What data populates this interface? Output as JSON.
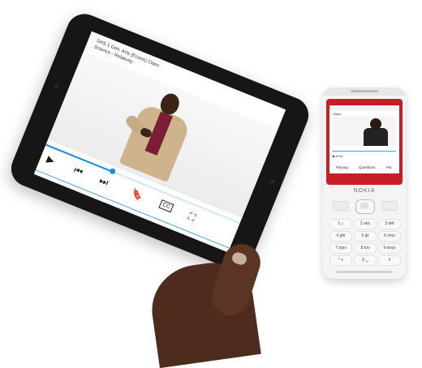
{
  "tablet": {
    "video_title_line1": "SHS 1 Gen. Arts (Econs) Class",
    "video_title_line2": "Science - Relativity",
    "controls": {
      "play_icon": "▶",
      "prev_icon": "⏮",
      "next_icon": "⏭",
      "bookmark_icon": "🔖",
      "cc_label": "CC",
      "fullscreen_icon": "⛶"
    },
    "playback_progress": 0.34,
    "colors": {
      "accent": "#1e88e5",
      "bezel": "#161616"
    }
  },
  "phone": {
    "brand": "NOKIA",
    "screen_title": "Video",
    "tabs": [
      "Playing",
      "Questions",
      "Pla"
    ],
    "keys": [
      "1 ⌂",
      "2 abc",
      "3 def",
      "4 ghi",
      "5 jkl",
      "6 mno",
      "7 pqrs",
      "8 tuv",
      "9 wxyz",
      "* +",
      "0 ␣",
      "#"
    ],
    "colors": {
      "frame": "#c81d25",
      "body": "#f4f4f4"
    }
  }
}
